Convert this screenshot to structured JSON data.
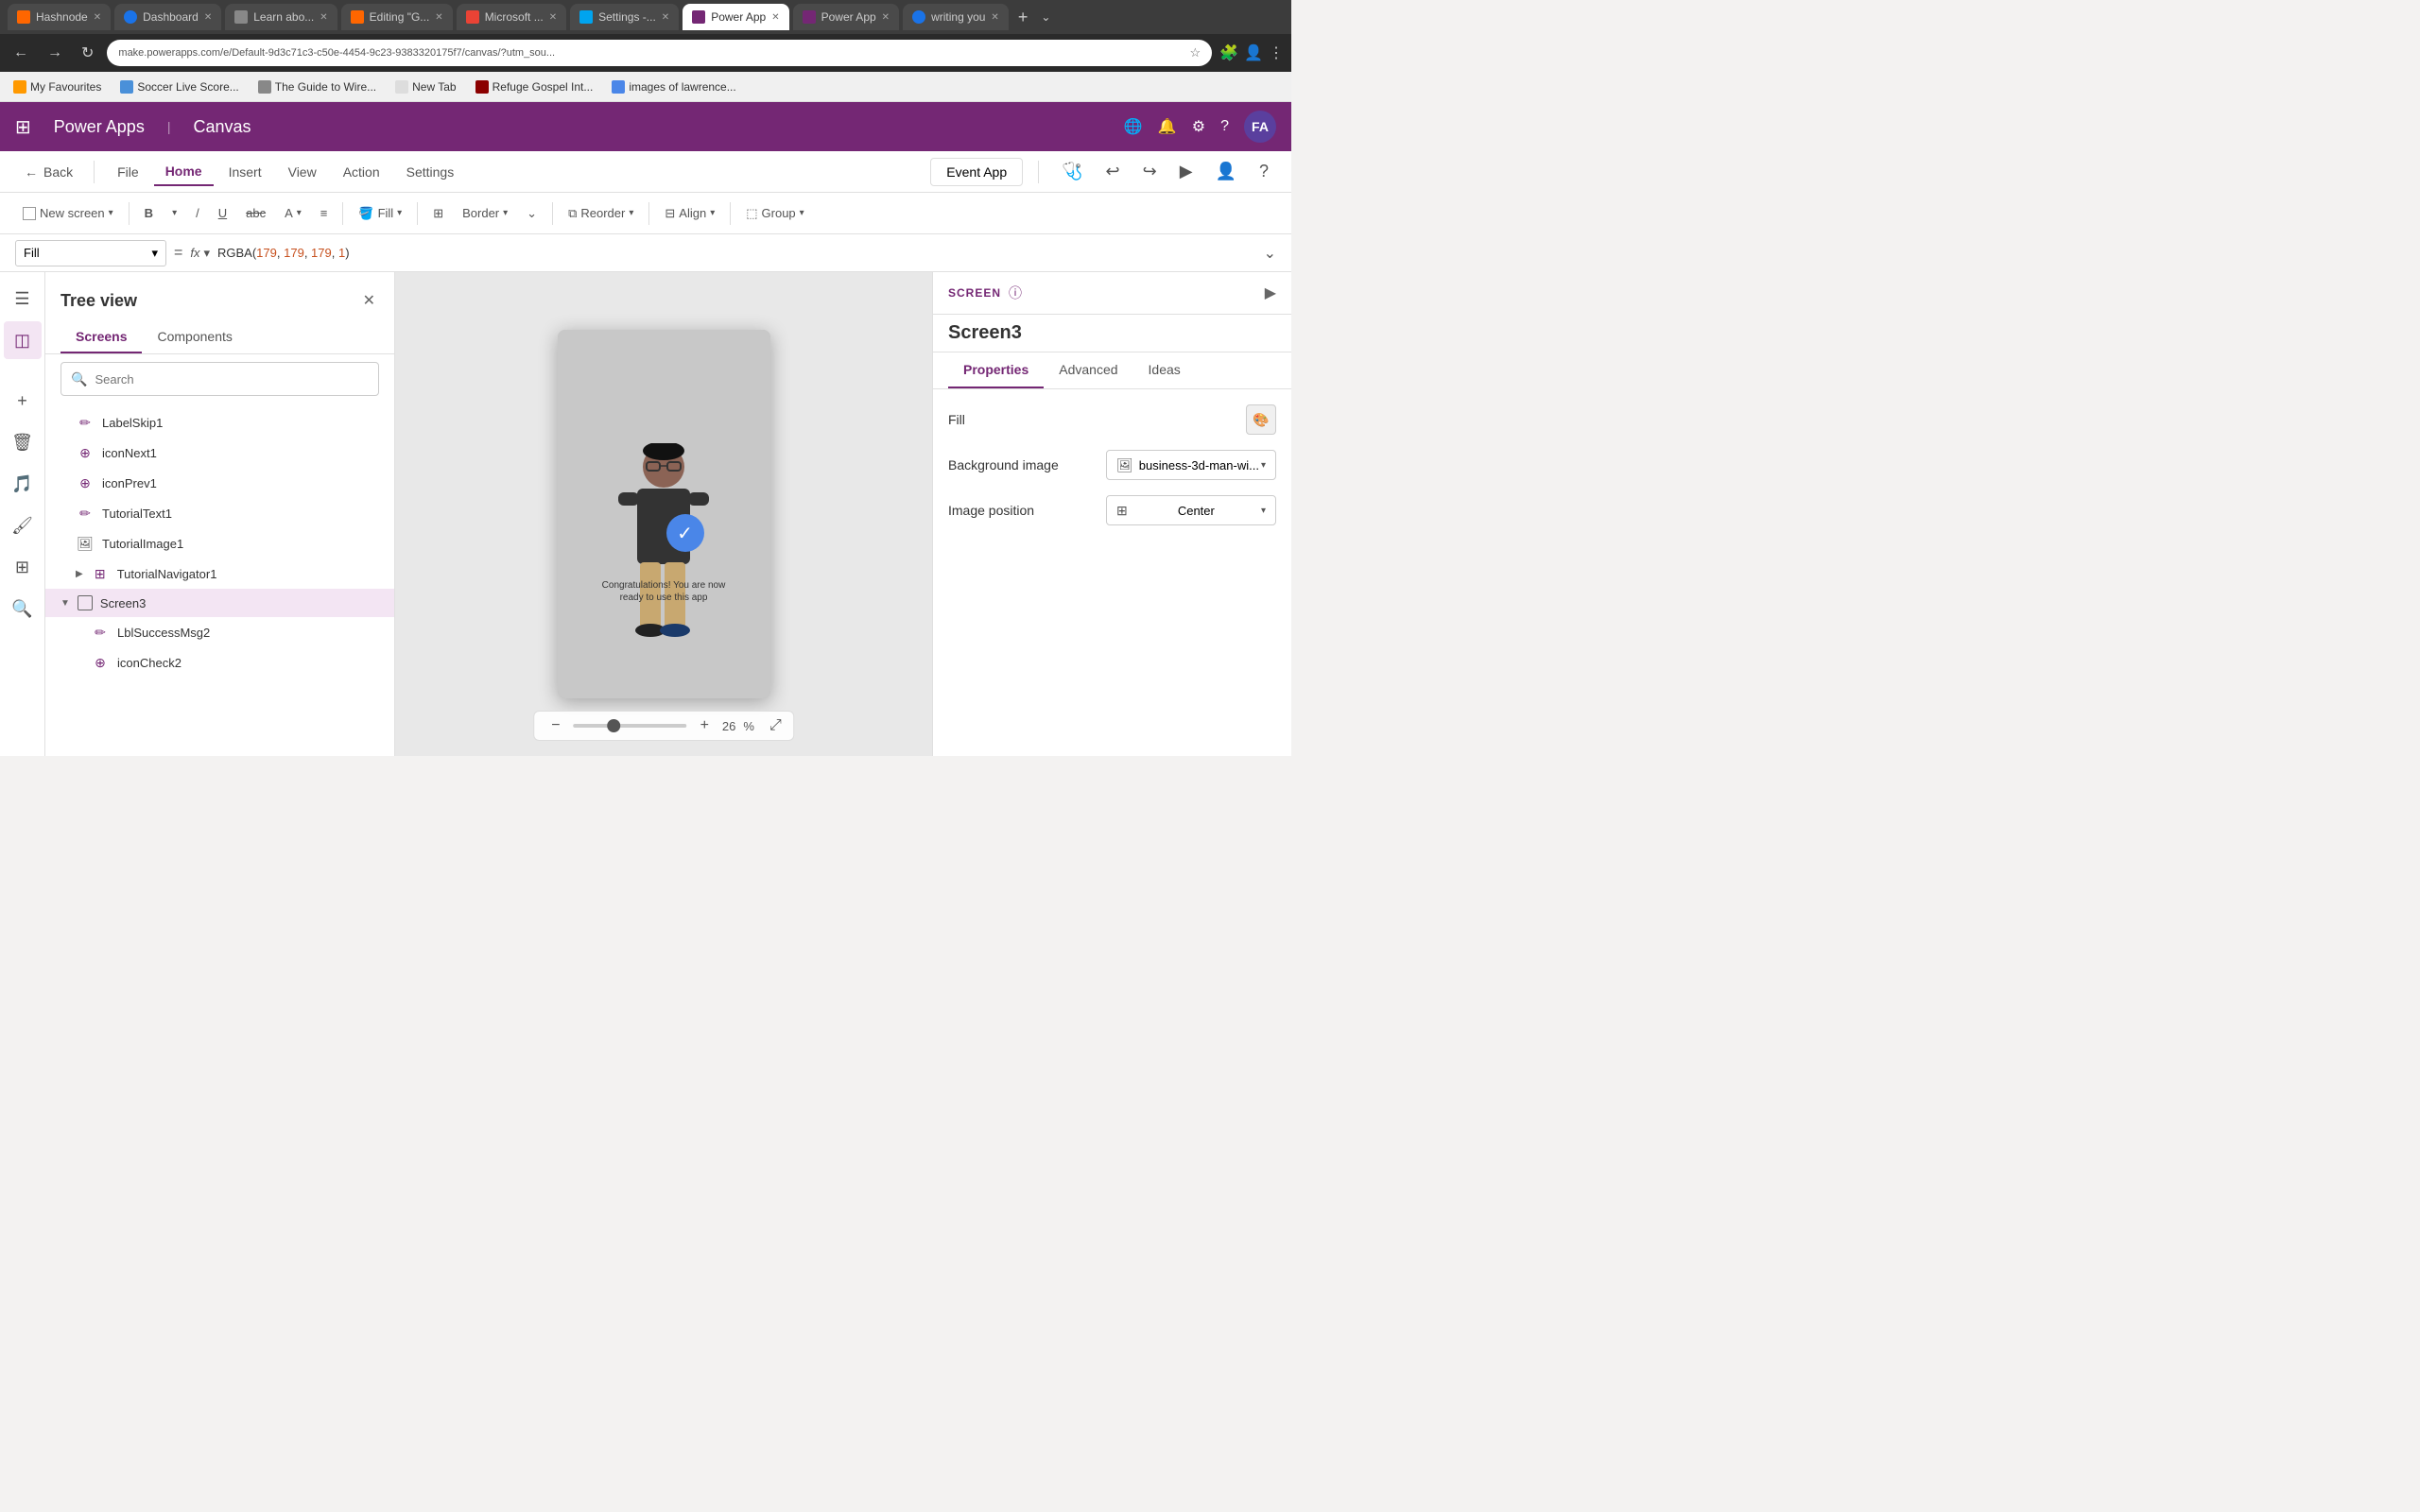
{
  "browser": {
    "tabs": [
      {
        "label": "Hashnode",
        "favicon_color": "#ff6600",
        "active": false
      },
      {
        "label": "Dashboard",
        "favicon_color": "#1a73e8",
        "active": false
      },
      {
        "label": "Learn abo...",
        "favicon_color": "#888",
        "active": false
      },
      {
        "label": "Editing \"G...",
        "favicon_color": "#ff6600",
        "active": false
      },
      {
        "label": "Microsoft ...",
        "favicon_color": "#ea4335",
        "active": false
      },
      {
        "label": "Settings -...",
        "favicon_color": "#00a4ef",
        "active": false
      },
      {
        "label": "Power App",
        "favicon_color": "#742774",
        "active": true
      },
      {
        "label": "Power App",
        "favicon_color": "#742774",
        "active": false
      },
      {
        "label": "writing you",
        "favicon_color": "#1a73e8",
        "active": false
      }
    ],
    "address": "make.powerapps.com/e/Default-9d3c71c3-c50e-4454-9c23-9383320175f7/canvas/?utm_sou...",
    "bookmarks": [
      {
        "label": "My Favourites"
      },
      {
        "label": "Soccer Live Score..."
      },
      {
        "label": "The Guide to Wire..."
      },
      {
        "label": "New Tab"
      },
      {
        "label": "Refuge Gospel Int..."
      },
      {
        "label": "images of lawrence..."
      }
    ]
  },
  "app": {
    "title": "Power Apps",
    "separator": "|",
    "subtitle": "Canvas",
    "avatar": "FA"
  },
  "menu": {
    "back_label": "Back",
    "items": [
      "File",
      "Home",
      "Insert",
      "View",
      "Action",
      "Settings"
    ],
    "active_item": "Home",
    "event_app": "Event App"
  },
  "toolbar": {
    "new_screen": "New screen",
    "fill": "Fill",
    "border": "Border",
    "reorder": "Reorder",
    "align": "Align",
    "group": "Group"
  },
  "formula": {
    "selector": "Fill",
    "value": "RGBA(179,  179,  179,  1)"
  },
  "tree_panel": {
    "title": "Tree view",
    "tabs": [
      "Screens",
      "Components"
    ],
    "active_tab": "Screens",
    "search_placeholder": "Search",
    "items": [
      {
        "label": "LabelSkip1",
        "type": "label",
        "indent": 1
      },
      {
        "label": "iconNext1",
        "type": "icon",
        "indent": 1
      },
      {
        "label": "iconPrev1",
        "type": "icon",
        "indent": 1
      },
      {
        "label": "TutorialText1",
        "type": "label",
        "indent": 1
      },
      {
        "label": "TutorialImage1",
        "type": "image",
        "indent": 1
      },
      {
        "label": "TutorialNavigator1",
        "type": "group",
        "indent": 1,
        "expandable": true
      },
      {
        "label": "Screen3",
        "type": "screen",
        "indent": 0,
        "expanded": true,
        "selected": true
      },
      {
        "label": "LblSuccessMsg2",
        "type": "label",
        "indent": 2
      },
      {
        "label": "iconCheck2",
        "type": "icon",
        "indent": 2
      }
    ]
  },
  "canvas": {
    "zoom_value": "26",
    "zoom_unit": "%",
    "congratulations_text": "Congratulations! You are now ready to use this app"
  },
  "right_panel": {
    "screen_label": "SCREEN",
    "screen_name": "Screen3",
    "tabs": [
      "Properties",
      "Advanced",
      "Ideas"
    ],
    "active_tab": "Properties",
    "fill_label": "Fill",
    "background_image_label": "Background image",
    "background_image_value": "business-3d-man-wi...",
    "image_position_label": "Image position",
    "image_position_value": "Center"
  }
}
